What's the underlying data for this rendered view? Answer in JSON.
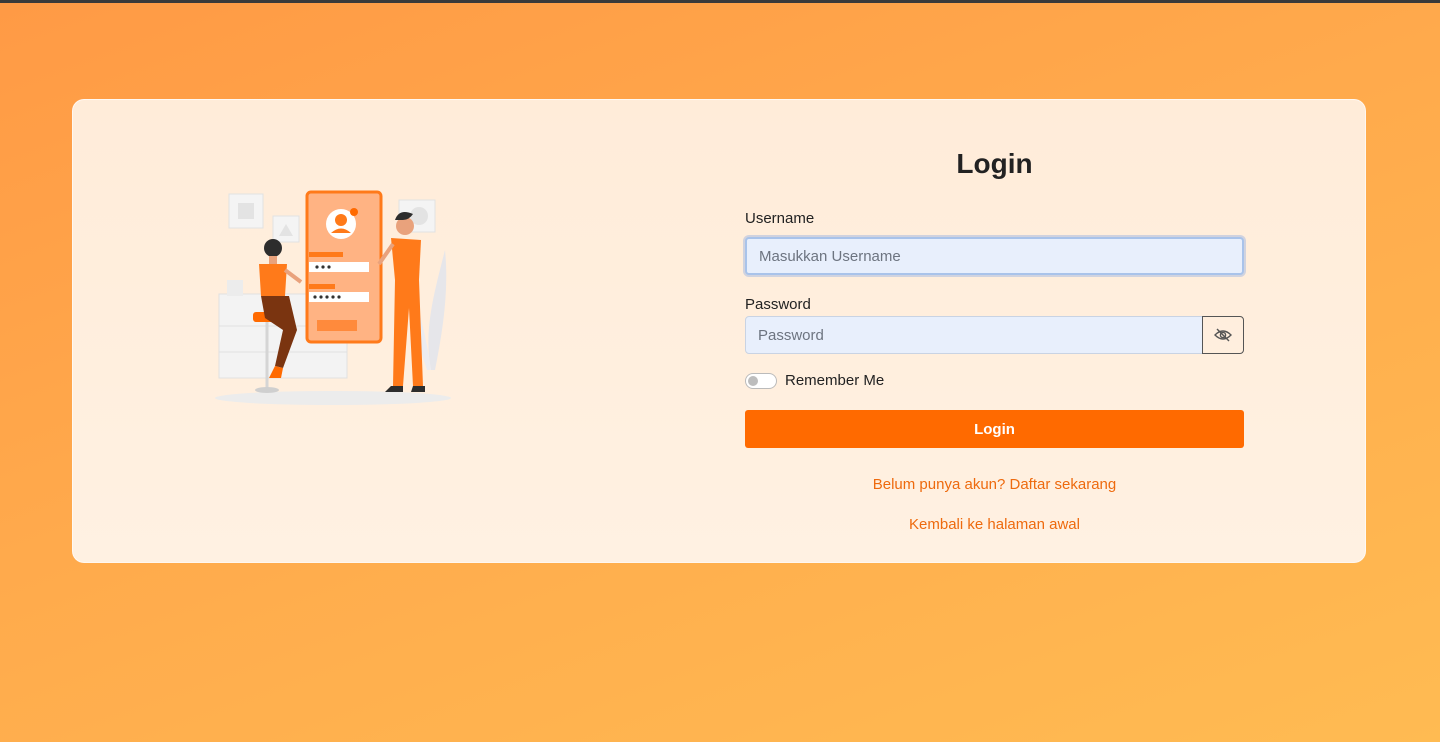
{
  "login": {
    "title": "Login",
    "username_label": "Username",
    "username_placeholder": "Masukkan Username",
    "username_value": "",
    "password_label": "Password",
    "password_placeholder": "Password",
    "password_value": "",
    "password_toggle_icon": "eye-slash-icon",
    "remember_label": "Remember Me",
    "remember_checked": false,
    "submit_label": "Login",
    "register_link": "Belum punya akun? Daftar sekarang",
    "back_link": "Kembali ke halaman awal"
  },
  "colors": {
    "primary": "#ff6a00",
    "link": "#ee6a0e",
    "background_start": "#ff9a45",
    "background_end": "#ffbb52",
    "card": "#fff1e2"
  }
}
